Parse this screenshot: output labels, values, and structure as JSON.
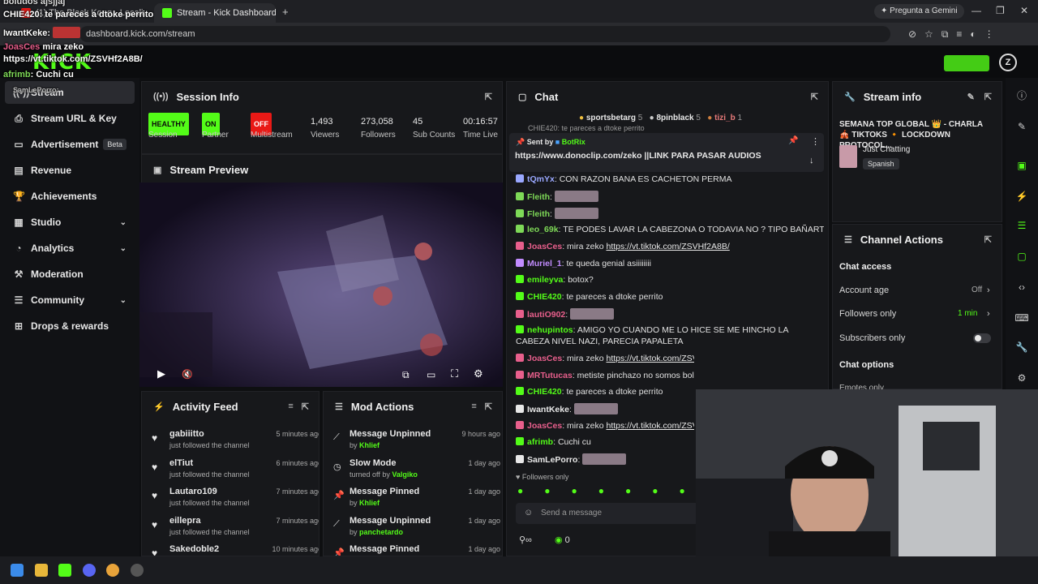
{
  "browser": {
    "tabs": [
      {
        "label": "(1) The Black Kong - Locali..."
      },
      {
        "label": "Stream - Kick Dashboard"
      }
    ],
    "new_tab": "+",
    "url": "dashboard.kick.com/stream",
    "gemini_button": "Pregunta a Gemini",
    "window_controls": [
      "—",
      "❐",
      "✕"
    ]
  },
  "overlay_chat": [
    {
      "user": "",
      "text": "boludos ajsjjaj"
    },
    {
      "user": "CHIE420",
      "text": ": te pareces a dtoke perrito"
    },
    {
      "user": "IwantKeke:",
      "text": ""
    },
    {
      "user": "JoasCes",
      "text": " mira zeko"
    },
    {
      "user": "",
      "text": "https://vt.tiktok.com/ZSVHf2A8B/"
    },
    {
      "user": "afrimb",
      "text": ": Cuchi cu"
    },
    {
      "user": "SamLePorro:",
      "text": ""
    }
  ],
  "logo": "KICK",
  "sidebar": {
    "items": [
      {
        "label": "Stream",
        "icon": "broadcast-icon",
        "active": true
      },
      {
        "label": "Stream URL & Key",
        "icon": "link-icon"
      },
      {
        "label": "Advertisement",
        "icon": "tv-icon",
        "badge": "Beta"
      },
      {
        "label": "Revenue",
        "icon": "chart-icon"
      },
      {
        "label": "Achievements",
        "icon": "trophy-icon"
      },
      {
        "label": "Studio",
        "icon": "grid-icon",
        "chevron": true
      },
      {
        "label": "Analytics",
        "icon": "analytics-icon",
        "chevron": true
      },
      {
        "label": "Moderation",
        "icon": "gavel-icon"
      },
      {
        "label": "Community",
        "icon": "community-icon",
        "chevron": true
      },
      {
        "label": "Drops & rewards",
        "icon": "gift-icon"
      }
    ]
  },
  "session": {
    "title": "Session Info",
    "stats": [
      {
        "value": "HEALTHY",
        "label": "Session",
        "kind": "badge-green"
      },
      {
        "value": "ON",
        "label": "Partner",
        "kind": "badge-green"
      },
      {
        "value": "OFF",
        "label": "Multistream",
        "kind": "badge-red"
      },
      {
        "value": "1,493",
        "label": "Viewers"
      },
      {
        "value": "273,058",
        "label": "Followers"
      },
      {
        "value": "45",
        "label": "Sub Counts"
      },
      {
        "value": "00:16:57",
        "label": "Time Live"
      }
    ]
  },
  "preview": {
    "title": "Stream Preview"
  },
  "activity": {
    "title": "Activity Feed",
    "items": [
      {
        "name": "gabiiitto",
        "sub": "just followed the channel",
        "time": "5 minutes ago"
      },
      {
        "name": "elTiut",
        "sub": "just followed the channel",
        "time": "6 minutes ago"
      },
      {
        "name": "Lautaro109",
        "sub": "just followed the channel",
        "time": "7 minutes ago"
      },
      {
        "name": "eillepra",
        "sub": "just followed the channel",
        "time": "7 minutes ago"
      },
      {
        "name": "Sakedoble2",
        "sub": "",
        "time": "10 minutes ago"
      }
    ]
  },
  "mod": {
    "title": "Mod Actions",
    "items": [
      {
        "name": "Message Unpinned",
        "by": "by",
        "who": "Khlief",
        "time": "9 hours ago",
        "icon": "unpin-icon"
      },
      {
        "name": "Slow Mode",
        "by": "turned off by",
        "who": "Valgiko",
        "time": "1 day ago",
        "icon": "slow-mode-icon"
      },
      {
        "name": "Message Pinned",
        "by": "by",
        "who": "Khlief",
        "time": "1 day ago",
        "icon": "pin-icon"
      },
      {
        "name": "Message Unpinned",
        "by": "by",
        "who": "panchetardo",
        "time": "1 day ago",
        "icon": "unpin-icon"
      },
      {
        "name": "Message Pinned",
        "by": "",
        "who": "",
        "time": "1 day ago",
        "icon": "pin-icon"
      }
    ]
  },
  "chat": {
    "title": "Chat",
    "top_gifters": [
      {
        "name": "sportsbetarg",
        "count": "5"
      },
      {
        "name": "8pinblack",
        "count": "5"
      },
      {
        "name": "tizi_b",
        "count": "1"
      }
    ],
    "pinned": {
      "sent_by_label": "Sent by",
      "sender": "BotRix",
      "link": "https://www.donoclip.com/zeko",
      "text": " ||LINK PARA PASAR AUDIOS",
      "behind": "CHIE420: te pareces a dtoke perrito"
    },
    "messages": [
      {
        "user": "tQmYx",
        "color": "#9aa8ff",
        "text": "CON RAZON BANA ES CACHETON PERMA"
      },
      {
        "user": "Fleith",
        "color": "#7ed957",
        "text": "",
        "emote": true
      },
      {
        "user": "Fleith",
        "color": "#7ed957",
        "text": "",
        "emote": true
      },
      {
        "user": "leo_69k",
        "color": "#7ed957",
        "text": "TE PODES LAVAR LA CABEZONA O TODAVIA NO ? TIPO BAÑARTE"
      },
      {
        "user": "JoasCes",
        "color": "#e85f8c",
        "text": "mira zeko ",
        "link": "https://vt.tiktok.com/ZSVHf2A8B/"
      },
      {
        "user": "Muriel_1",
        "color": "#c28cff",
        "text": "te queda genial asiiiiiiii"
      },
      {
        "user": "emileyva",
        "color": "#53fc18",
        "text": "botox?"
      },
      {
        "user": "CHIE420",
        "color": "#53fc18",
        "text": "te pareces a dtoke perrito"
      },
      {
        "user": "lautiO902",
        "color": "#e85f8c",
        "text": "",
        "emote": true
      },
      {
        "user": "nehupintos",
        "color": "#53fc18",
        "text": "AMIGO YO CUANDO ME LO HICE SE ME HINCHO LA CABEZA NIVEL NAZI, PARECIA PAPALETA"
      },
      {
        "user": "JoasCes",
        "color": "#e85f8c",
        "text": "mira zeko ",
        "link": "https://vt.tiktok.com/ZSVHf2A8B/"
      },
      {
        "user": "MRTutucas",
        "color": "#e85f8c",
        "text": "metiste pinchazo no somos boludos ajsjjaj"
      },
      {
        "user": "CHIE420",
        "color": "#53fc18",
        "text": "te pareces a dtoke perrito"
      },
      {
        "user": "IwantKeke",
        "color": "#e8e8e8",
        "text": "",
        "emote": true
      },
      {
        "user": "JoasCes",
        "color": "#e85f8c",
        "text": "mira zeko ",
        "link": "https://vt.tiktok.com/ZSVH"
      },
      {
        "user": "afrimb",
        "color": "#53fc18",
        "text": "Cuchi cu"
      },
      {
        "user": "SamLePorro",
        "color": "#e8e8e8",
        "text": "",
        "emote": true
      }
    ],
    "followers_only": "Followers only",
    "input_placeholder": "Send a message",
    "points": "0"
  },
  "stream_info": {
    "title": "Stream info",
    "stream_title": "SEMANA TOP GLOBAL 👑 - CHARLA 🎪 TIKTOKS 🔸 LOCKDOWN PROTOCOL...",
    "category": "Just Chatting",
    "language": "Spanish"
  },
  "channel_actions": {
    "title": "Channel Actions",
    "chat_access": "Chat access",
    "rows": [
      {
        "label": "Account age",
        "value": "Off"
      },
      {
        "label": "Followers only",
        "value": "1 min"
      },
      {
        "label": "Subscribers only",
        "value": ""
      }
    ],
    "chat_options": "Chat options",
    "emotes_only": "Emotes only"
  },
  "colors": {
    "kick_green": "#53fc18",
    "offline_red": "#e91916",
    "panel_bg": "#17181b"
  }
}
